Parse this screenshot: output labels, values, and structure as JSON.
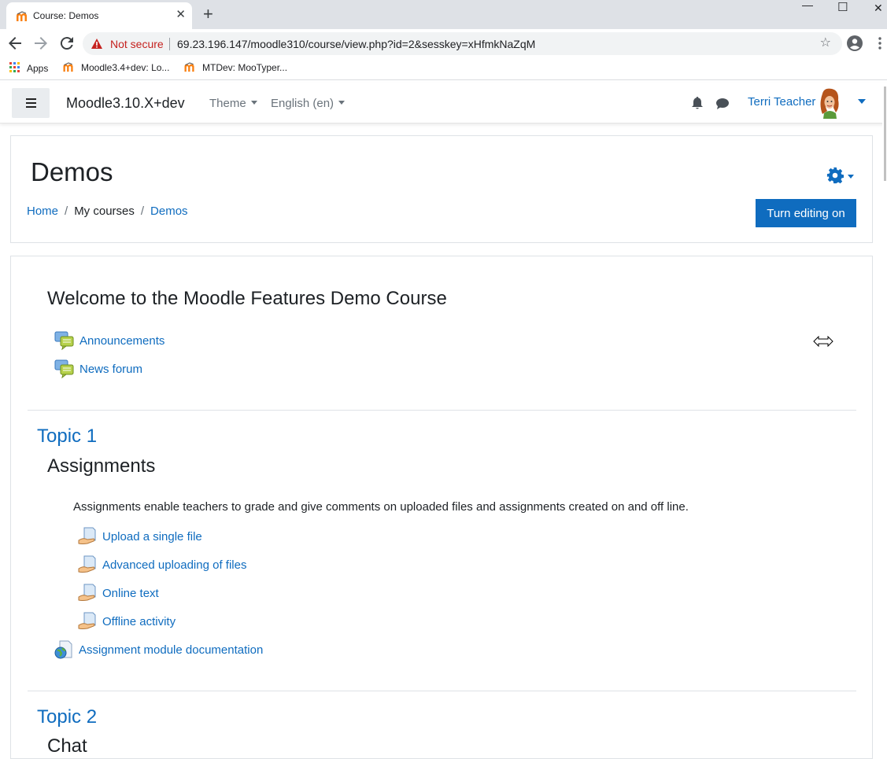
{
  "browser": {
    "tab_title": "Course: Demos",
    "new_tab": "+",
    "close_tab": "✕",
    "minimize": "—",
    "maximize": "☐",
    "close_window": "✕",
    "security_label": "Not secure",
    "url": "69.23.196.147/moodle310/course/view.php?id=2&sesskey=xHfmkNaZqM",
    "bookmarks": [
      "Apps",
      "Moodle3.4+dev: Lo...",
      "MTDev: MooTyper..."
    ]
  },
  "navbar": {
    "brand": "Moodle3.10.X+dev",
    "menus": [
      "Theme",
      "English (en)"
    ],
    "user_name": "Terri Teacher"
  },
  "header": {
    "title": "Demos",
    "breadcrumb": [
      "Home",
      "My courses",
      "Demos"
    ],
    "edit_button": "Turn editing on"
  },
  "course": {
    "welcome_title": "Welcome to the Moodle Features Demo Course",
    "forums": [
      "Announcements",
      "News forum"
    ],
    "topic1": {
      "label": "Topic 1",
      "title": "Assignments",
      "summary": "Assignments enable teachers to grade and give comments on uploaded files and assignments created on and off line.",
      "assignments": [
        "Upload a single file",
        "Advanced uploading of files",
        "Online text",
        "Offline activity"
      ],
      "url_resource": "Assignment module documentation"
    },
    "topic2": {
      "label": "Topic 2",
      "title": "Chat"
    }
  },
  "colors": {
    "primary": "#0f6cbf",
    "not_secure": "#c5221f",
    "text": "#1d2125"
  },
  "icons": [
    "moodle-favicon",
    "warning-icon",
    "star-icon",
    "account-icon",
    "menu-dots-icon",
    "apps-icon",
    "hamburger-icon",
    "bell-icon",
    "chat-icon",
    "avatar",
    "gear-icon",
    "forum-icon",
    "assignment-icon",
    "url-icon",
    "resize-cursor-icon"
  ]
}
